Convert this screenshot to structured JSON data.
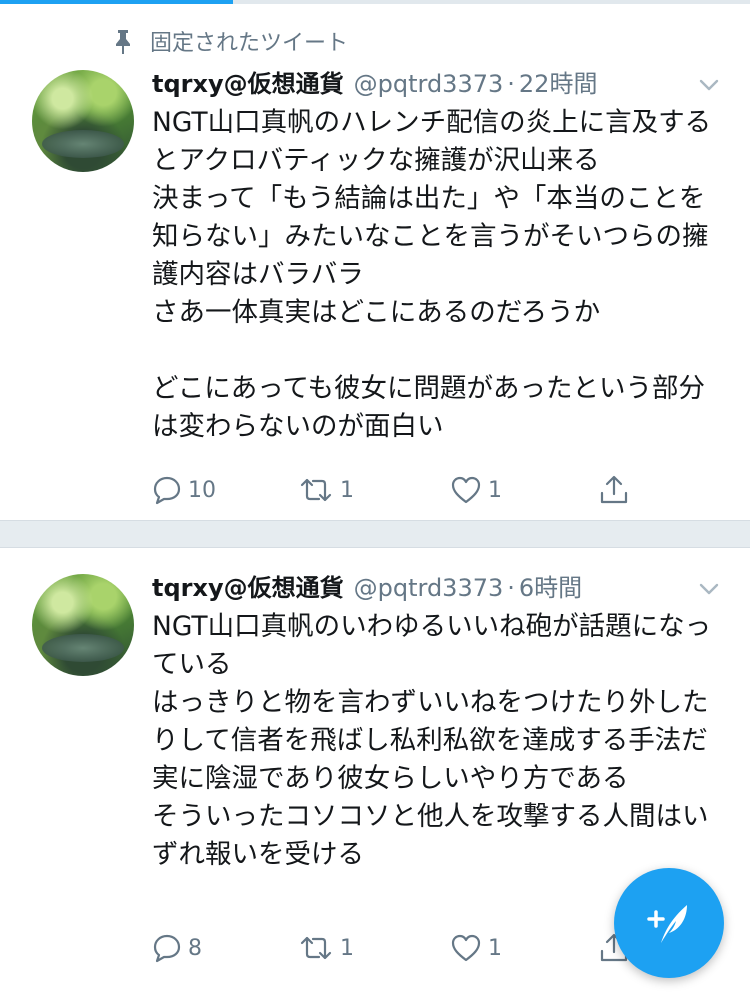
{
  "loading_progress": 0.31,
  "colors": {
    "accent": "#1da1f2",
    "muted": "#657786",
    "text": "#14171a",
    "separator": "#e6ecf0"
  },
  "tweets": [
    {
      "pinned_label": "固定されたツイート",
      "display_name": "tqrxy@仮想通貨",
      "handle": "@pqtrd3373",
      "separator_dot": "·",
      "time": "22時間",
      "text": "NGT山口真帆のハレンチ配信の炎上に言及するとアクロバティックな擁護が沢山来る\n決まって「もう結論は出た」や「本当のことを知らない」みたいなことを言うがそいつらの擁護内容はバラバラ\nさあ一体真実はどこにあるのだろうか\n\nどこにあっても彼女に問題があったという部分は変わらないのが面白い",
      "reply_count": "10",
      "retweet_count": "1",
      "like_count": "1"
    },
    {
      "display_name": "tqrxy@仮想通貨",
      "handle": "@pqtrd3373",
      "separator_dot": "·",
      "time": "6時間",
      "text": "NGT山口真帆のいわゆるいいね砲が話題になっている\nはっきりと物を言わずいいねをつけたり外したりして信者を飛ばし私利私欲を達成する手法だ\n実に陰湿であり彼女らしいやり方である\nそういったコソコソと他人を攻撃する人間はいずれ報いを受ける",
      "reply_count": "8",
      "retweet_count": "1",
      "like_count": "1"
    }
  ],
  "icons": {
    "pin": "pin-icon",
    "chevron": "chevron-down-icon",
    "reply": "reply-icon",
    "retweet": "retweet-icon",
    "like": "heart-icon",
    "share": "share-icon",
    "compose": "compose-tweet-icon"
  }
}
